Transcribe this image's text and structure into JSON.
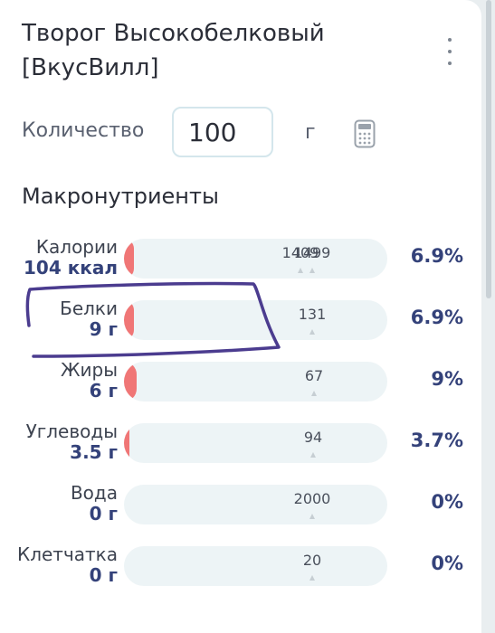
{
  "product": {
    "title": "Творог Высокобелковый [ВкусВилл]"
  },
  "quantity": {
    "label": "Количество",
    "value": "100",
    "unit": "г"
  },
  "icons": {
    "menu": "more-vertical-icon",
    "calculator": "calculator-icon"
  },
  "macros": {
    "title": "Макронутриенты",
    "rows": [
      {
        "name": "Калории",
        "amount": "104 ккал",
        "percent": "6.9%",
        "fill": 0.069,
        "marks": [
          "1409",
          "1499"
        ],
        "mark_positions": [
          1409,
          1499
        ],
        "scale_max": 2100
      },
      {
        "name": "Белки",
        "amount": "9 г",
        "percent": "6.9%",
        "fill": 0.069,
        "marks": [
          "",
          "131"
        ],
        "mark_positions": [
          null,
          131
        ],
        "scale_max": 183
      },
      {
        "name": "Жиры",
        "amount": "6 г",
        "percent": "9%",
        "fill": 0.09,
        "marks": [
          "",
          "67"
        ],
        "mark_positions": [
          null,
          67
        ],
        "scale_max": 93
      },
      {
        "name": "Углеводы",
        "amount": "3.5 г",
        "percent": "3.7%",
        "fill": 0.037,
        "marks": [
          "",
          "94"
        ],
        "mark_positions": [
          null,
          94
        ],
        "scale_max": 131
      },
      {
        "name": "Вода",
        "amount": "0 г",
        "percent": "0%",
        "fill": 0,
        "marks": [
          "",
          "2000"
        ],
        "mark_positions": [
          null,
          2000
        ],
        "scale_max": 2800
      },
      {
        "name": "Клетчатка",
        "amount": "0 г",
        "percent": "0%",
        "fill": 0,
        "marks": [
          "",
          "20"
        ],
        "mark_positions": [
          null,
          20
        ],
        "scale_max": 28
      }
    ]
  },
  "colors": {
    "fill": "#f07676",
    "track": "#edf4f6",
    "accent": "#34427a",
    "annotation": "#4b3c8f"
  }
}
